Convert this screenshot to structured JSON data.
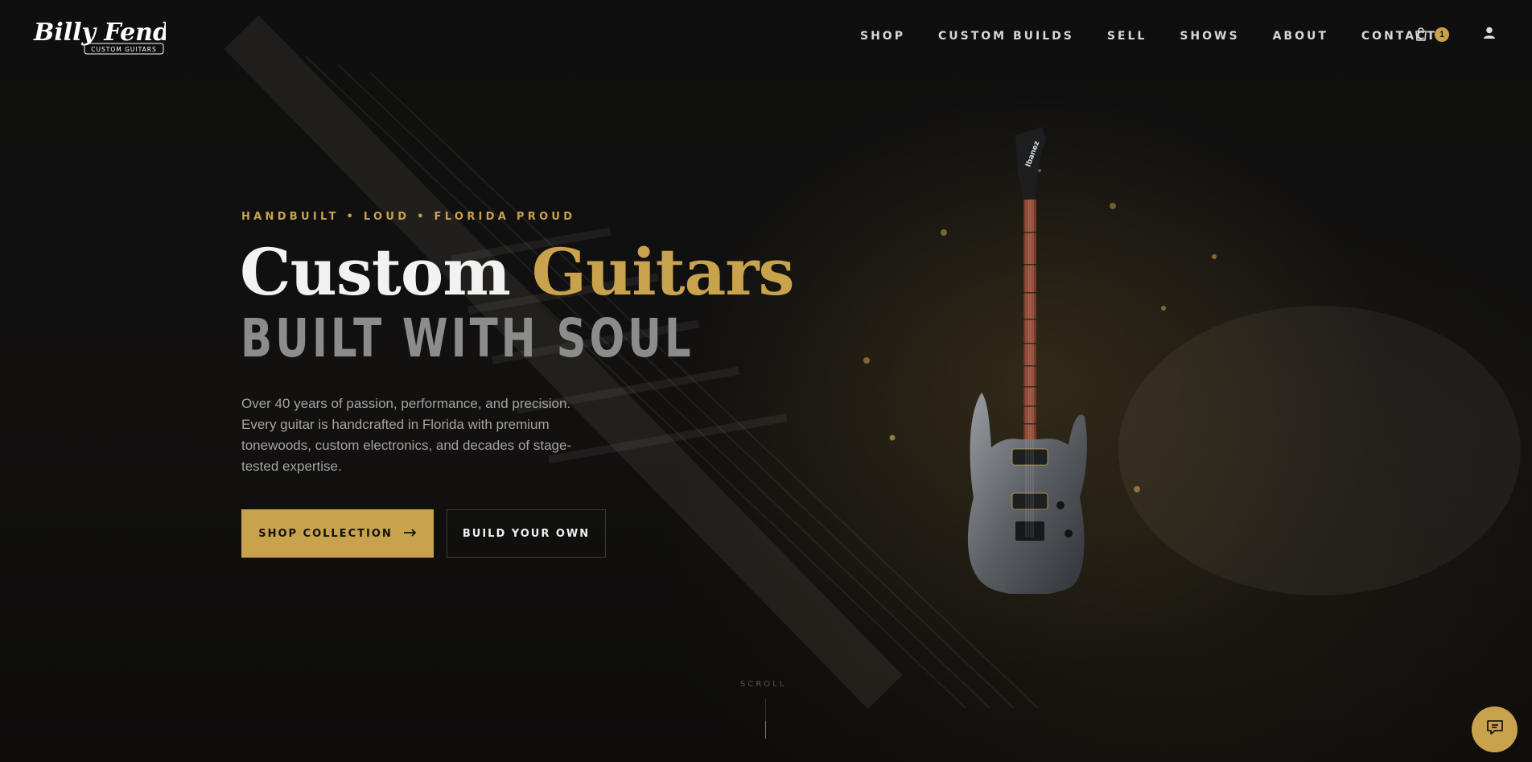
{
  "brand": {
    "name": "Billy Fender",
    "tagline": "CUSTOM GUITARS"
  },
  "nav": [
    {
      "label": "SHOP"
    },
    {
      "label": "CUSTOM BUILDS"
    },
    {
      "label": "SELL"
    },
    {
      "label": "SHOWS"
    },
    {
      "label": "ABOUT"
    },
    {
      "label": "CONTACT"
    }
  ],
  "cart": {
    "icon": "cart-icon",
    "count": "1"
  },
  "account": {
    "icon": "user-icon"
  },
  "hero": {
    "eyebrow": "HANDBUILT • LOUD • FLORIDA PROUD",
    "title_white": "Custom",
    "title_gold": "Guitars",
    "subtitle": "BUILT WITH SOUL",
    "description": "Over 40 years of passion, performance, and precision. Every guitar is handcrafted in Florida with premium tonewoods, custom electronics, and decades of stage-tested expertise.",
    "primary_cta": "SHOP COLLECTION",
    "primary_cta_icon": "arrow-right-icon",
    "secondary_cta": "BUILD YOUR OWN",
    "guitar_headstock_text": "Ibanez"
  },
  "scroll": {
    "label": "SCROLL"
  },
  "chat": {
    "icon": "chat-icon"
  },
  "colors": {
    "accent": "#c9a24d",
    "background": "#0d0d0d",
    "muted": "#8c8c8c"
  }
}
